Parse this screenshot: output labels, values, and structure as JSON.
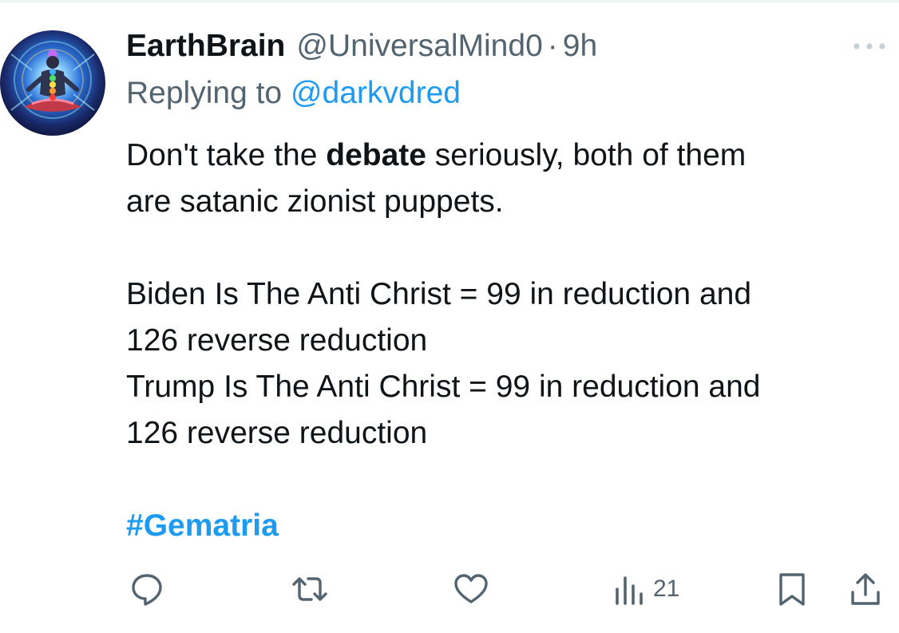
{
  "tweet": {
    "author": {
      "display_name": "EarthBrain",
      "handle": "@UniversalMind0",
      "avatar_icon": "meditation-chakra-avatar"
    },
    "separator": "·",
    "time": "9h",
    "reply": {
      "prefix": "Replying to ",
      "handle": "@darkvdred"
    },
    "body": {
      "p1_before": "Don't take the ",
      "p1_bold": "debate",
      "p1_after": " seriously, both of them",
      "p1_line2": "are satanic zionist puppets.",
      "line3": "Biden Is The Anti Christ = 99 in reduction and",
      "line4": "126 reverse reduction",
      "line5": "Trump Is The Anti Christ = 99 in reduction and",
      "line6": "126 reverse reduction",
      "hashtag": "#Gematria"
    },
    "actions": {
      "reply_icon": "comment-icon",
      "retweet_icon": "retweet-icon",
      "like_icon": "heart-icon",
      "views_icon": "analytics-icon",
      "views_count": "21",
      "bookmark_icon": "bookmark-icon",
      "share_icon": "share-icon"
    },
    "colors": {
      "accent": "#1d9bf0",
      "secondary_text": "#536471",
      "primary_text": "#0f1419"
    }
  }
}
